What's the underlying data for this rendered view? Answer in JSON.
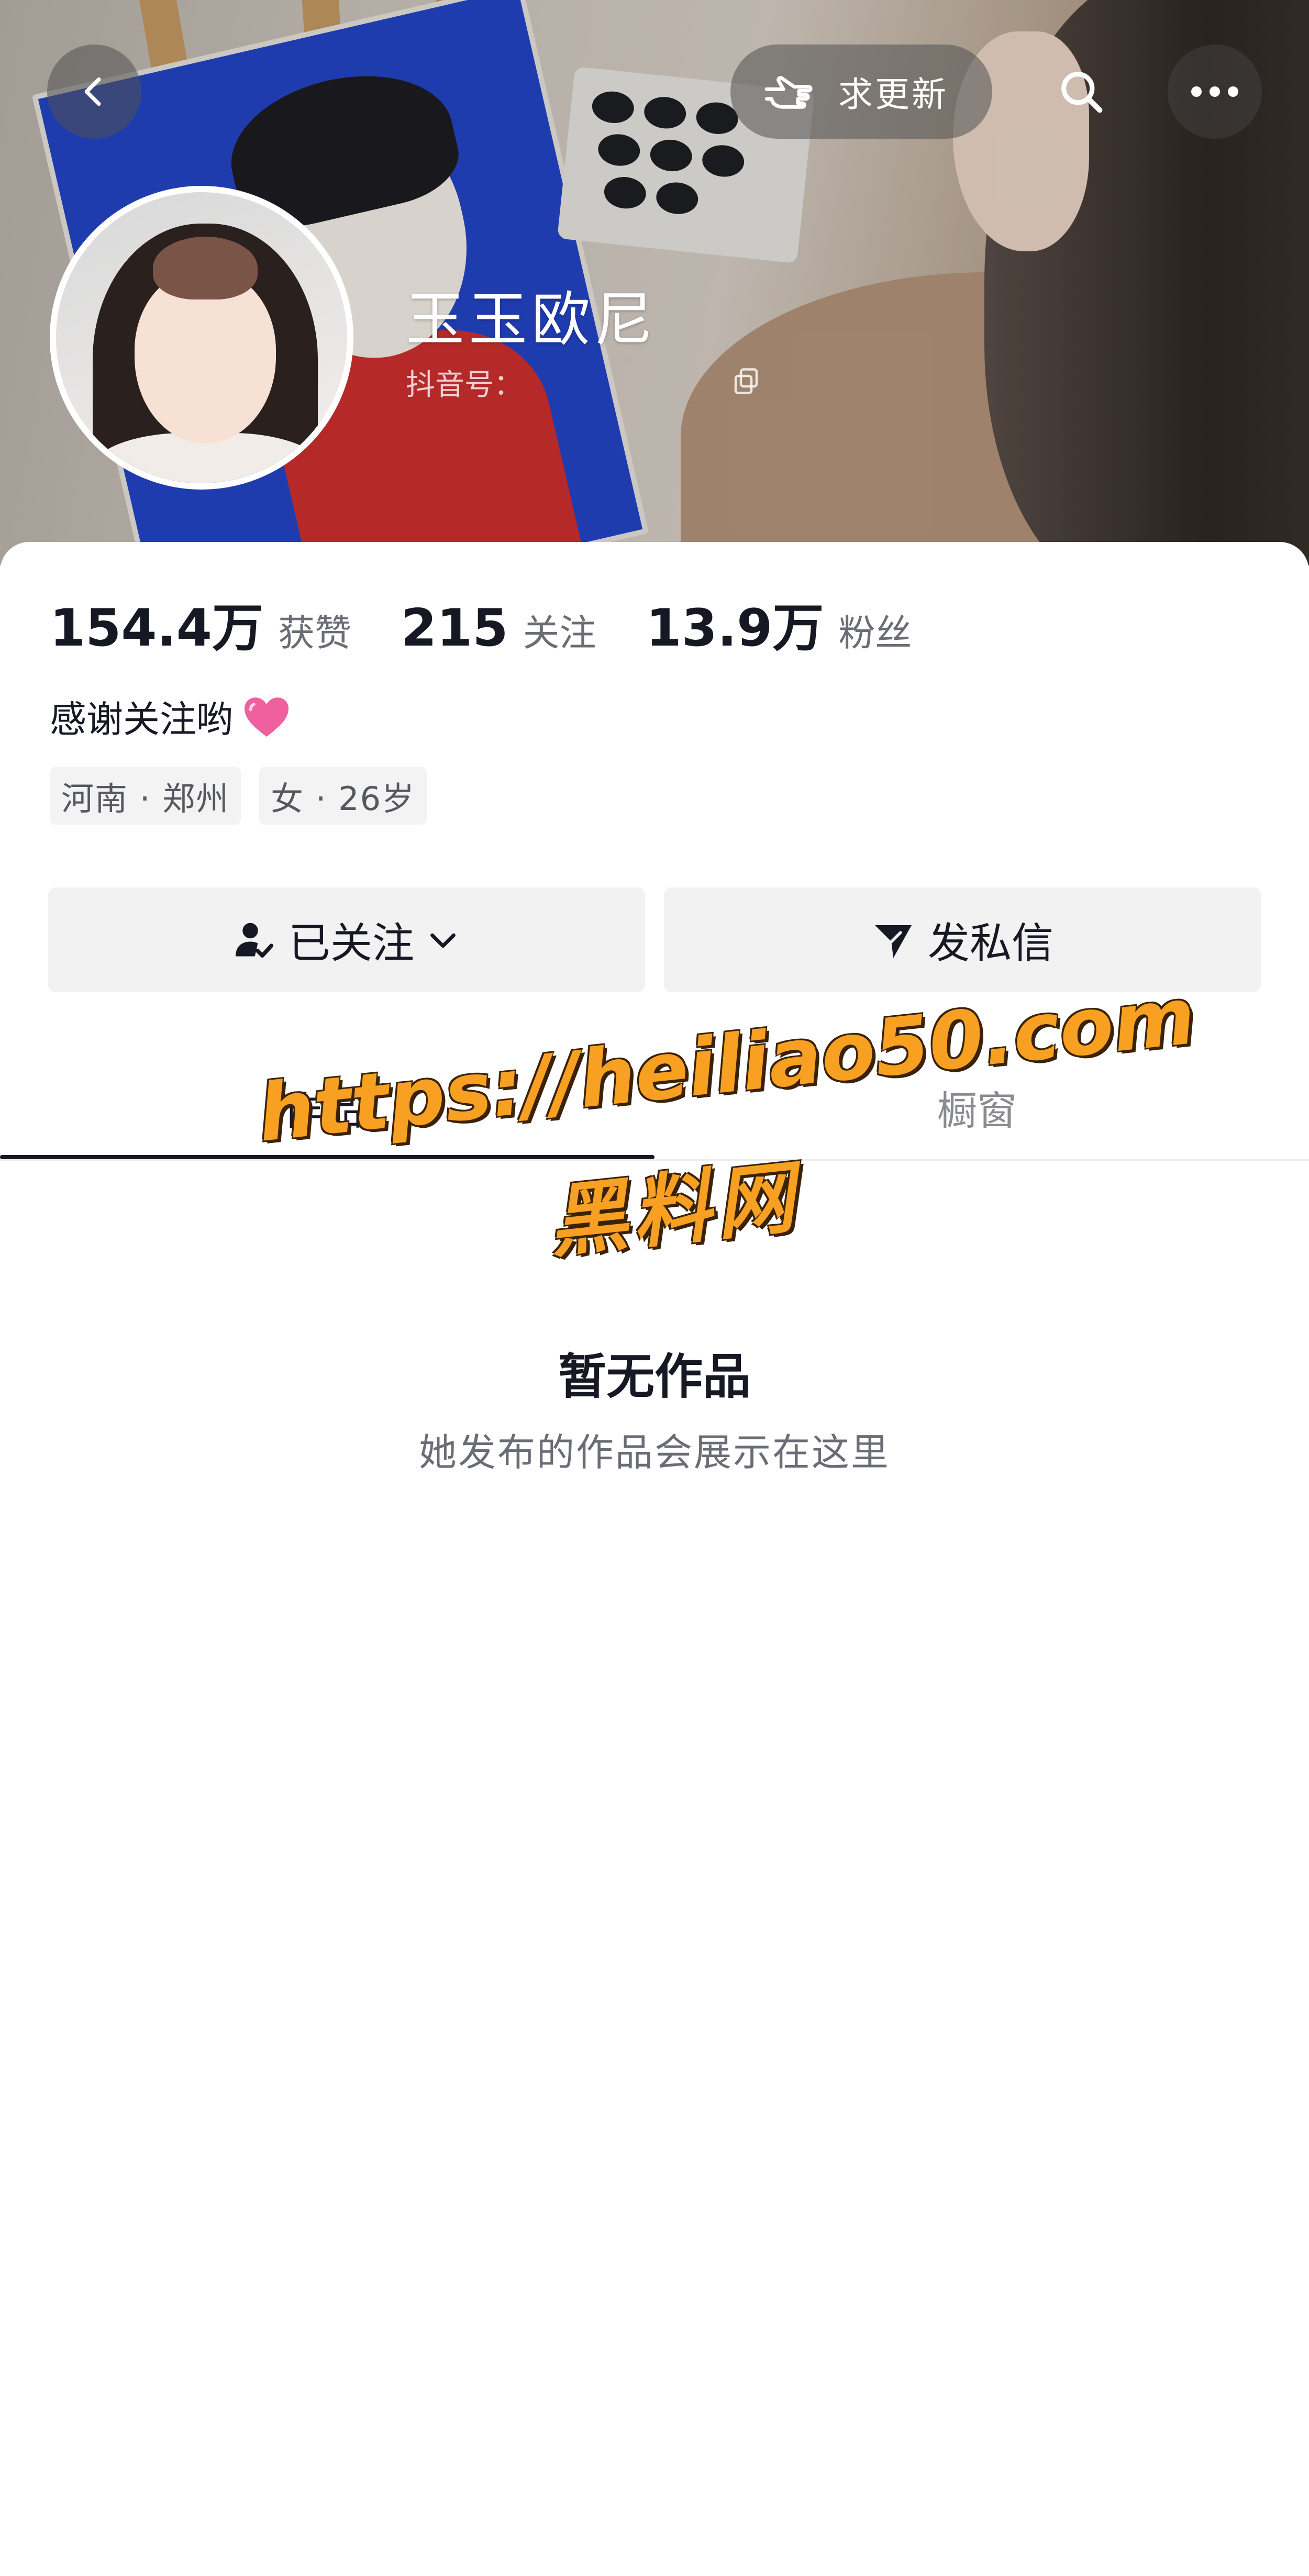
{
  "header": {
    "back_icon": "chevron-left-icon",
    "request_update_label": "求更新",
    "request_update_icon": "pointing-hand-icon",
    "search_icon": "search-icon",
    "more_icon": "more-dots-icon"
  },
  "profile": {
    "name": "玉玉欧尼",
    "douyin_id_label": "抖音号：",
    "copy_icon": "copy-icon",
    "stats": [
      {
        "value": "154.4万",
        "label": "获赞"
      },
      {
        "value": "215",
        "label": "关注"
      },
      {
        "value": "13.9万",
        "label": "粉丝"
      }
    ],
    "bio": "感谢关注哟",
    "bio_emoji_icon": "pink-heart-icon",
    "tags": [
      "河南 · 郑州",
      "女 · 26岁"
    ]
  },
  "actions": {
    "followed_label": "已关注",
    "message_label": "发私信"
  },
  "tabs": [
    {
      "label": "作品",
      "active": true
    },
    {
      "label": "橱窗",
      "active": false
    }
  ],
  "empty_state": {
    "title": "暂无作品",
    "subtitle": "她发布的作品会展示在这里"
  },
  "watermark": {
    "url": "https://heiliao50.com",
    "name": "黑料网"
  },
  "colors": {
    "text_primary": "#161823",
    "text_secondary": "#6b6d75",
    "button_bg": "#f2f2f3",
    "watermark_fill": "#f7a022",
    "heart": "#f0609e"
  }
}
